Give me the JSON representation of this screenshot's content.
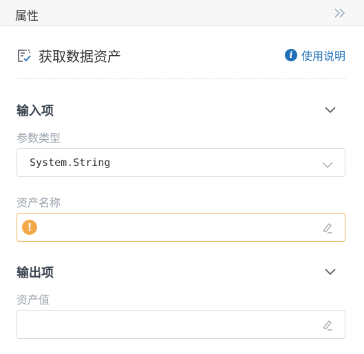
{
  "panel": {
    "title": "属性"
  },
  "action": {
    "name": "获取数据资产",
    "help_label": "使用说明"
  },
  "inputs": {
    "section_title": "输入项",
    "param_type_label": "参数类型",
    "param_type_value": "System.String",
    "asset_name_label": "资产名称",
    "asset_name_value": ""
  },
  "outputs": {
    "section_title": "输出项",
    "asset_value_label": "资产值",
    "asset_value_value": ""
  },
  "colors": {
    "accent": "#1e6fb8",
    "warning": "#f3a94a"
  },
  "icons": {
    "collapse": "double-chevron-right-icon",
    "action": "data-asset-icon",
    "help": "info-icon",
    "toggle": "chevron-down-icon",
    "warning": "exclamation-icon",
    "edit": "pencil-icon"
  }
}
